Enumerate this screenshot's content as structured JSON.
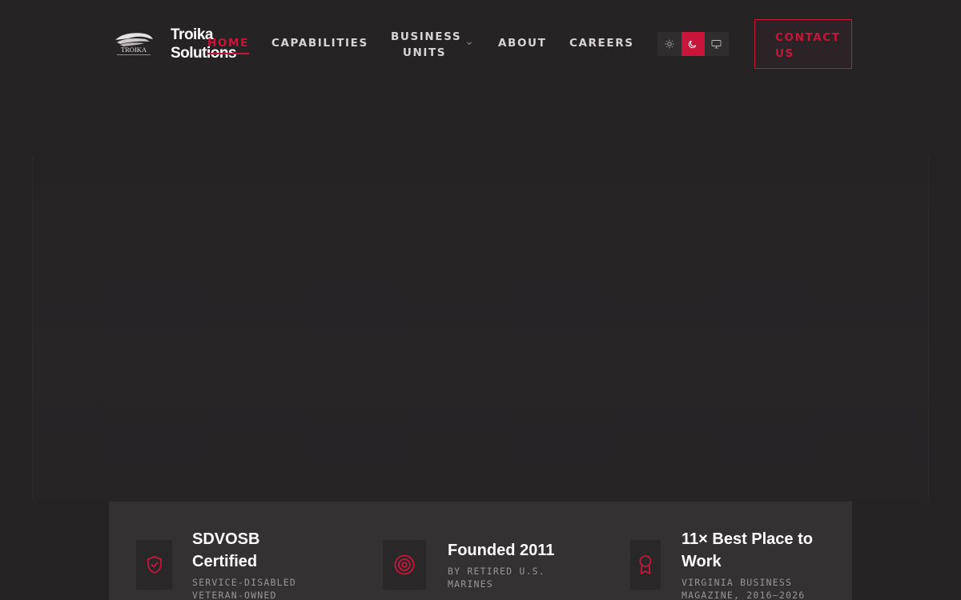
{
  "header": {
    "brand_line1": "Troika",
    "brand_line2": "Solutions",
    "logo_text": "TROIKA",
    "nav": {
      "home": "HOME",
      "capabilities": "CAPABILITIES",
      "business_units_line1": "BUSINESS",
      "business_units_line2": "UNITS",
      "about": "ABOUT",
      "careers": "CAREERS"
    },
    "theme_options": [
      "light",
      "dark",
      "system"
    ],
    "theme_selected": "dark",
    "contact_line1": "CONTACT",
    "contact_line2": "US"
  },
  "stats": [
    {
      "title_line1": "SDVOSB",
      "title_line2": "Certified",
      "sub_line1": "SERVICE-DISABLED",
      "sub_line2": "VETERAN-OWNED",
      "icon": "shield-check-icon"
    },
    {
      "title_line1": "Founded 2011",
      "title_line2": "",
      "sub_line1": "BY RETIRED U.S.",
      "sub_line2": "MARINES",
      "icon": "target-icon"
    },
    {
      "title_line1": "11× Best Place to",
      "title_line2": "Work",
      "sub_line1": "VIRGINIA BUSINESS",
      "sub_line2": "MAGAZINE, 2016–2026",
      "icon": "award-ribbon-icon"
    }
  ],
  "colors": {
    "accent": "#c8163b",
    "background": "#252324",
    "band": "#343132"
  }
}
